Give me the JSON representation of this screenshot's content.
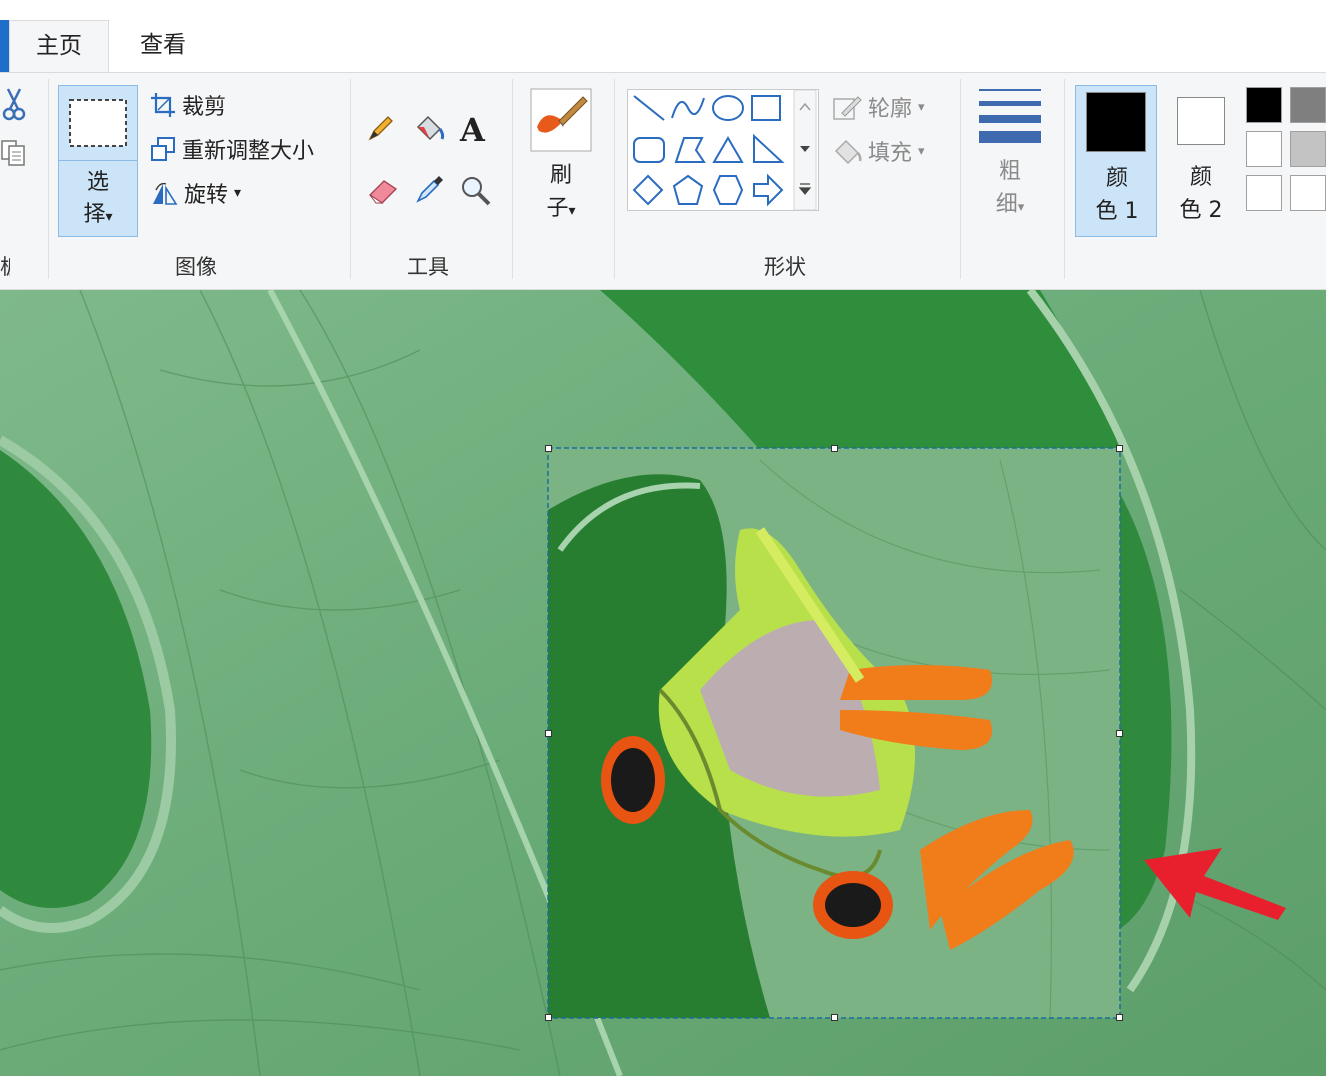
{
  "tabs": {
    "home": "主页",
    "view": "查看"
  },
  "image_group": {
    "label": "图像",
    "select_label_1": "选",
    "select_label_2": "择",
    "crop": "裁剪",
    "resize": "重新调整大小",
    "rotate": "旋转"
  },
  "clipboard_group": {
    "label_fragment": "板"
  },
  "tools_group": {
    "label": "工具"
  },
  "brush": {
    "label_1": "刷",
    "label_2": "子"
  },
  "shapes_group": {
    "label": "形状",
    "outline": "轮廓",
    "fill": "填充"
  },
  "size": {
    "label_1": "粗",
    "label_2": "细"
  },
  "colors": {
    "color1_label_1": "颜",
    "color1_label_2": "色 1",
    "color2_label_1": "颜",
    "color2_label_2": "色 2",
    "color1": "#000000",
    "color2": "#ffffff",
    "palette": [
      "#000000",
      "#7f7f7f",
      "#ffffff",
      "#c3c3c3",
      "#ffffff",
      "#ffffff"
    ]
  },
  "accent": "#1e6fc9",
  "selection_highlight": "#cce4f7",
  "annotation_arrow_color": "#e8202e"
}
